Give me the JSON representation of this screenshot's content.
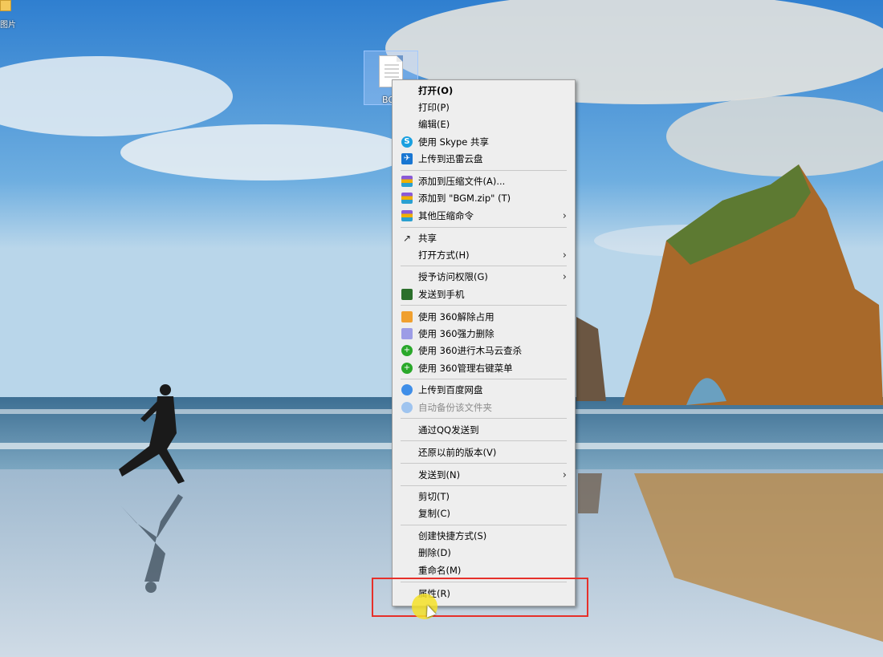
{
  "desktop": {
    "partial_icon_label": "图片",
    "file_icon_name": "BG"
  },
  "context_menu": {
    "items": [
      {
        "label": "打开(O)",
        "icon": "",
        "submenu": false
      },
      {
        "label": "打印(P)",
        "icon": "",
        "submenu": false
      },
      {
        "label": "编辑(E)",
        "icon": "",
        "submenu": false
      },
      {
        "label": "使用 Skype 共享",
        "icon": "skype-icon",
        "submenu": false
      },
      {
        "label": "上传到迅雷云盘",
        "icon": "xunlei-icon",
        "submenu": false
      },
      {
        "label": "添加到压缩文件(A)...",
        "icon": "winrar-icon",
        "submenu": false
      },
      {
        "label": "添加到 \"BGM.zip\" (T)",
        "icon": "winrar-icon",
        "submenu": false
      },
      {
        "label": "其他压缩命令",
        "icon": "winrar-icon",
        "submenu": true
      },
      {
        "label": "共享",
        "icon": "share-icon",
        "submenu": false
      },
      {
        "label": "打开方式(H)",
        "icon": "",
        "submenu": true
      },
      {
        "label": "授予访问权限(G)",
        "icon": "",
        "submenu": true
      },
      {
        "label": "发送到手机",
        "icon": "phone-icon",
        "submenu": false
      },
      {
        "label": "使用 360解除占用",
        "icon": "360-unlock-icon",
        "submenu": false
      },
      {
        "label": "使用 360强力删除",
        "icon": "360-delete-icon",
        "submenu": false
      },
      {
        "label": "使用 360进行木马云查杀",
        "icon": "360-scan-icon",
        "submenu": false
      },
      {
        "label": "使用 360管理右键菜单",
        "icon": "360-manage-icon",
        "submenu": false
      },
      {
        "label": "上传到百度网盘",
        "icon": "baidu-icon",
        "submenu": false
      },
      {
        "label": "自动备份该文件夹",
        "icon": "baidu-icon",
        "submenu": false
      },
      {
        "label": "通过QQ发送到",
        "icon": "",
        "submenu": false
      },
      {
        "label": "还原以前的版本(V)",
        "icon": "",
        "submenu": false
      },
      {
        "label": "发送到(N)",
        "icon": "",
        "submenu": true
      },
      {
        "label": "剪切(T)",
        "icon": "",
        "submenu": false
      },
      {
        "label": "复制(C)",
        "icon": "",
        "submenu": false
      },
      {
        "label": "创建快捷方式(S)",
        "icon": "",
        "submenu": false
      },
      {
        "label": "删除(D)",
        "icon": "",
        "submenu": false
      },
      {
        "label": "重命名(M)",
        "icon": "",
        "submenu": false
      },
      {
        "label": "属性(R)",
        "icon": "",
        "submenu": false
      }
    ],
    "submenu_arrow": "›"
  },
  "colors": {
    "highlight": "#e6302a",
    "menu_bg": "#eeeeee"
  }
}
